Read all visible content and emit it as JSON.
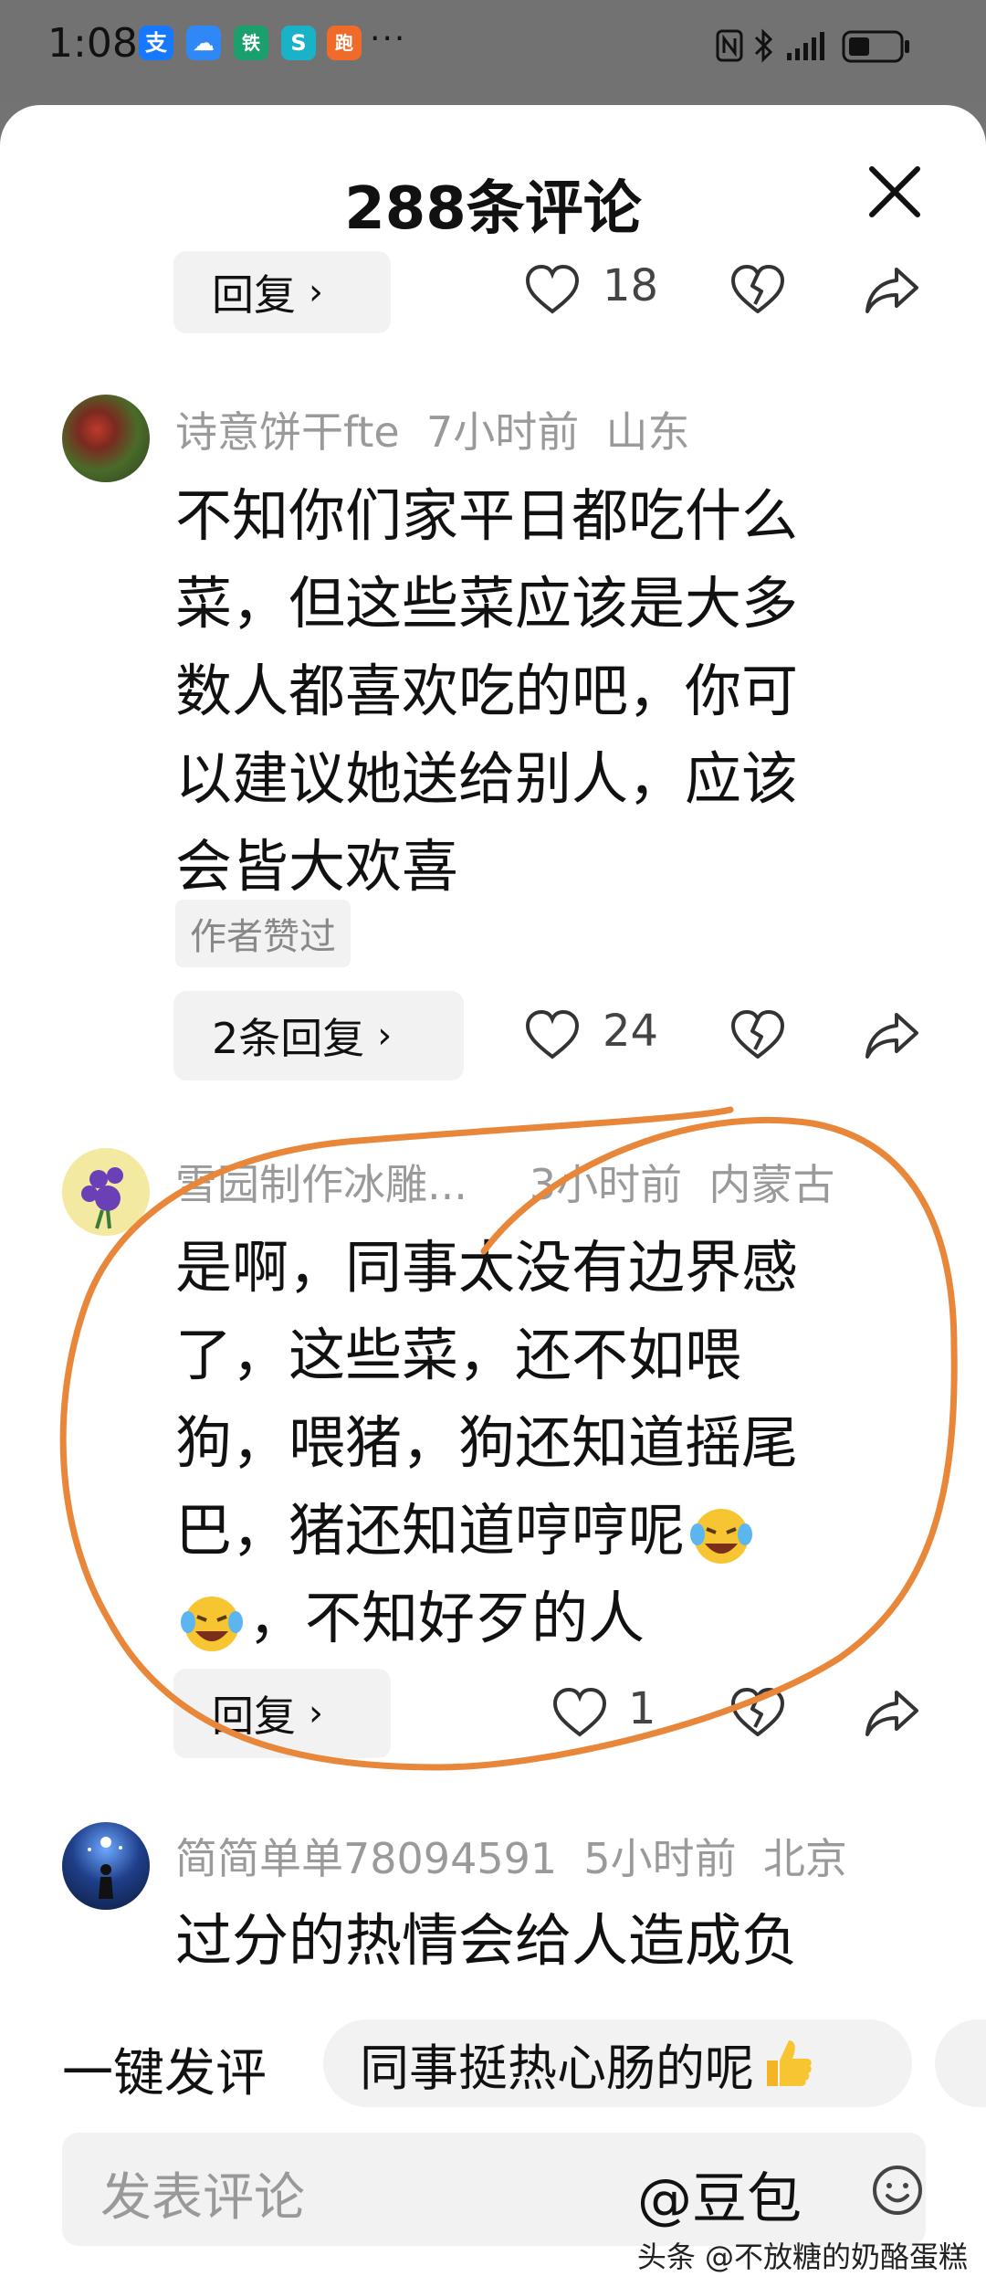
{
  "status_bar": {
    "time": "1:08",
    "app_icons": [
      {
        "name": "alipay-icon",
        "glyph": "支",
        "color": "#1677ff"
      },
      {
        "name": "cloud-app-icon",
        "glyph": "☁",
        "color": "#2f88f5"
      },
      {
        "name": "metro-app-icon",
        "glyph": "铁",
        "color": "#1aa06d"
      },
      {
        "name": "s-app-icon",
        "glyph": "S",
        "color": "#19b2c7"
      },
      {
        "name": "runner-app-icon",
        "glyph": "跑",
        "color": "#f06a2a"
      }
    ],
    "more": "···"
  },
  "sheet": {
    "title": "288条评论"
  },
  "top_partial": {
    "reply_label": "回复",
    "like_count": "18"
  },
  "comments": [
    {
      "username": "诗意饼干fte",
      "time": "7小时前",
      "location": "山东",
      "lines": [
        "不知你们家平日都吃什么",
        "菜，但这些菜应该是大多",
        "数人都喜欢吃的吧，你可",
        "以建议她送给别人，应该",
        "会皆大欢喜"
      ],
      "tag": "作者赞过",
      "reply_label": "2条回复",
      "like_count": "24"
    },
    {
      "username": "雪园制作冰雕...",
      "time": "3小时前",
      "location": "内蒙古",
      "lines": [
        "是啊，同事太没有边界感",
        "了，这些菜，还不如喂",
        "狗，喂猪，狗还知道摇尾",
        "巴，猪还知道哼哼呢",
        "，不知好歹的人"
      ],
      "reply_label": "回复",
      "like_count": "1"
    },
    {
      "username": "简简单单78094591",
      "time": "5小时前",
      "location": "北京",
      "lines": [
        "过分的热情会给人造成负"
      ]
    }
  ],
  "bottom": {
    "quick_label": "一键发评",
    "quick_chip": "同事挺热心肠的呢",
    "input_placeholder": "发表评论",
    "at_label": "@豆包",
    "watermark": "头条 @不放糖的奶酪蛋糕"
  },
  "colors": {
    "annotation": "#e8863a",
    "sheet_bg": "#ffffff",
    "dim_bg": "#727272"
  }
}
